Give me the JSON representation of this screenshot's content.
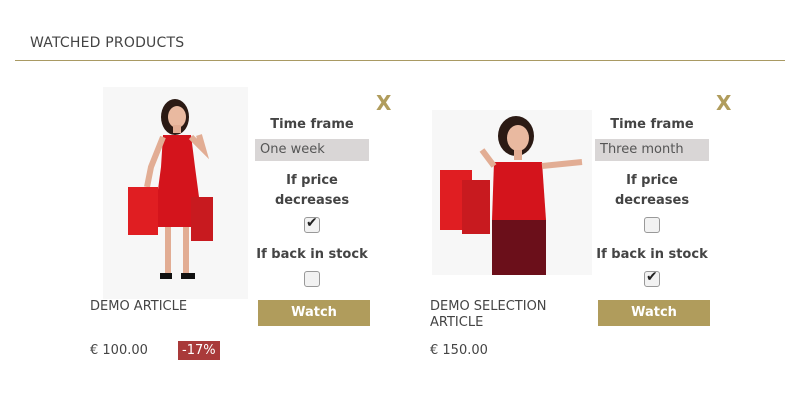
{
  "page": {
    "title": "WATCHED PRODUCTS"
  },
  "colors": {
    "accent": "#b09c5c",
    "badge": "#a93a3a",
    "rule": "#a99a63"
  },
  "labels": {
    "time_frame": "Time frame",
    "if_price_decreases": "If price decreases",
    "if_back_in_stock": "If back in stock",
    "watch": "Watch",
    "close": "X"
  },
  "products": [
    {
      "name": "DEMO ARTICLE",
      "price": "€ 100.00",
      "discount": "-17%",
      "time_frame_value": "One week",
      "price_decrease_checked": true,
      "back_in_stock_checked": false
    },
    {
      "name": "DEMO SELECTION ARTICLE",
      "price": "€ 150.00",
      "discount": "",
      "time_frame_value": "Three month",
      "price_decrease_checked": false,
      "back_in_stock_checked": true
    }
  ]
}
